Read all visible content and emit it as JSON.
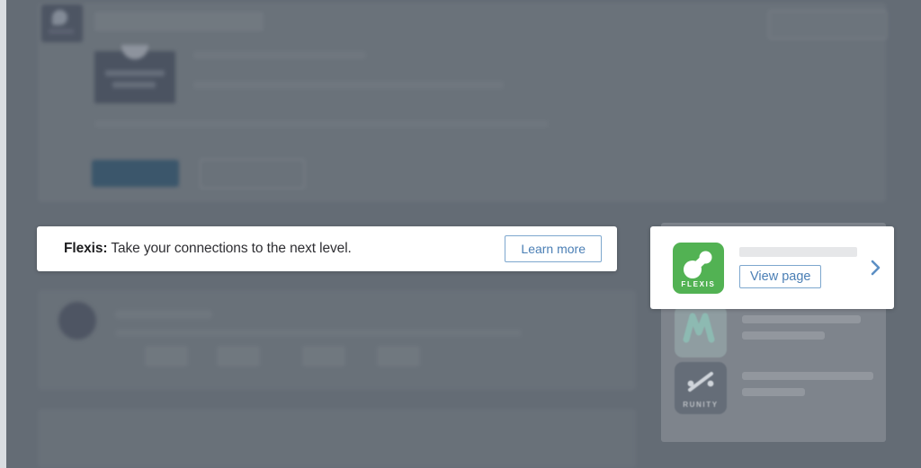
{
  "banner": {
    "brand": "Flexis:",
    "message": "Take your connections to the next level.",
    "cta_label": "Learn more"
  },
  "page_card": {
    "logo_wordmark": "FLEXIS",
    "logo_color": "#52b253",
    "title_placeholder": "",
    "cta_label": "View page",
    "chevron": "chevron-right-icon"
  },
  "sidebar": {
    "suggestions": [
      {
        "logo_wordmark": "",
        "logo_color": "#bad6ce"
      },
      {
        "logo_wordmark": "RUNITY",
        "logo_color": "#656d78"
      }
    ]
  },
  "colors": {
    "scrim": "#5f6771",
    "link_blue": "#4b7fb5",
    "border_blue": "#7da7ce",
    "banner_bg": "#ffffff",
    "brand_green": "#52b253"
  }
}
